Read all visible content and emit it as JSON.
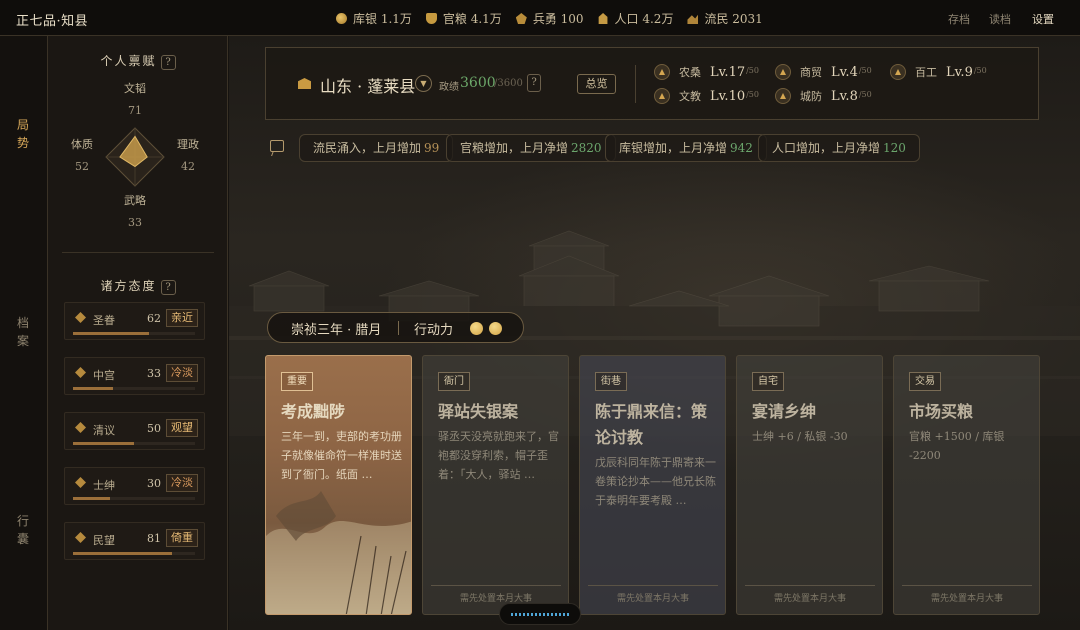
{
  "topbar": {
    "rank": "正七品·知县",
    "resources": [
      {
        "icon": "coin-icon",
        "label": "库银 1.1万"
      },
      {
        "icon": "grain-icon",
        "label": "官粮 4.1万"
      },
      {
        "icon": "soldier-icon",
        "label": "兵勇 100"
      },
      {
        "icon": "population-icon",
        "label": "人口 4.2万"
      },
      {
        "icon": "refugee-icon",
        "label": "流民 2031"
      }
    ],
    "save": "存档",
    "load": "读档",
    "settings": "设置"
  },
  "rail": {
    "situation": "局势",
    "archive": "档案",
    "luggage": "行囊"
  },
  "talents": {
    "title": "个人禀赋",
    "help": "?",
    "literary": {
      "name": "文韬",
      "value": "71"
    },
    "physique": {
      "name": "体质",
      "value": "52"
    },
    "governance": {
      "name": "理政",
      "value": "42"
    },
    "martial": {
      "name": "武略",
      "value": "33"
    },
    "radar": {
      "literary": 71,
      "governance": 42,
      "martial": 33,
      "physique": 52
    }
  },
  "attitudes": {
    "title": "诸方态度",
    "help": "?",
    "items": [
      {
        "name": "圣眷",
        "value": "62",
        "tag": "亲近",
        "level": 0.62,
        "icon": "imperial-icon"
      },
      {
        "name": "中宫",
        "value": "33",
        "tag": "冷淡",
        "level": 0.33,
        "icon": "palace-icon"
      },
      {
        "name": "清议",
        "value": "50",
        "tag": "观望",
        "level": 0.5,
        "icon": "scholar-icon"
      },
      {
        "name": "士绅",
        "value": "30",
        "tag": "冷淡",
        "level": 0.3,
        "icon": "gentry-icon"
      },
      {
        "name": "民望",
        "value": "81",
        "tag": "倚重",
        "level": 0.81,
        "icon": "people-icon"
      }
    ]
  },
  "county": {
    "name": "山东 · 蓬莱县",
    "perf_label": "政绩",
    "perf_value": "3600",
    "perf_max": "/3600",
    "help": "?",
    "overview": "总览",
    "industries": [
      {
        "name": "农桑",
        "level": "Lv.17",
        "max": "/50"
      },
      {
        "name": "商贸",
        "level": "Lv.4",
        "max": "/50"
      },
      {
        "name": "百工",
        "level": "Lv.9",
        "max": "/50"
      },
      {
        "name": "文教",
        "level": "Lv.10",
        "max": "/50"
      },
      {
        "name": "城防",
        "level": "Lv.8",
        "max": "/50"
      }
    ]
  },
  "events": [
    {
      "text": "流民涌入，上月增加",
      "value": "99",
      "tone": "amber"
    },
    {
      "text": "官粮增加，上月净增",
      "value": "2820",
      "tone": "green"
    },
    {
      "text": "库银增加，上月净增",
      "value": "942",
      "tone": "green"
    },
    {
      "text": "人口增加，上月净增",
      "value": "120",
      "tone": "green"
    }
  ],
  "turn": {
    "date": "崇祯三年 · 腊月",
    "action_label": "行动力",
    "action_points": 2
  },
  "cards": [
    {
      "tag": "重要",
      "title": "考成黜陟",
      "desc": "三年一到，吏部的考功册子就像催命符一样准时送到了衙门。纸面 …",
      "foot": ""
    },
    {
      "tag": "衙门",
      "title": "驿站失银案",
      "desc": "驿丞天没亮就跑来了，官袍都没穿利索，帽子歪着：「大人，驿站 …",
      "foot": "需先处置本月大事"
    },
    {
      "tag": "街巷",
      "title": "陈于鼎来信：策论讨教",
      "desc": "戊辰科同年陈于鼎寄来一卷策论抄本——他兄长陈于泰明年要考殿 …",
      "foot": "需先处置本月大事"
    },
    {
      "tag": "自宅",
      "title": "宴请乡绅",
      "desc": "士绅 +6 / 私银 -30",
      "foot": "需先处置本月大事"
    },
    {
      "tag": "交易",
      "title": "市场买粮",
      "desc": "官粮 +1500 / 库银 -2200",
      "foot": "需先处置本月大事"
    }
  ]
}
